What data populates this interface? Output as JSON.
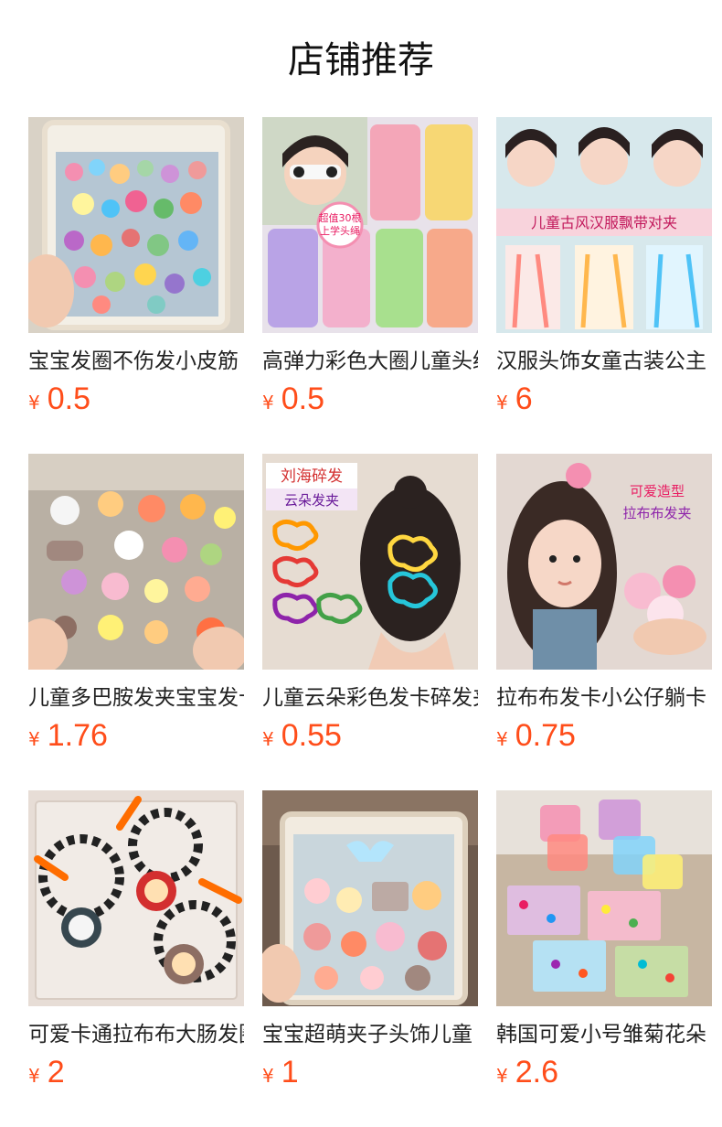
{
  "page": {
    "title": "店铺推荐"
  },
  "currency_symbol": "¥",
  "products": [
    {
      "name": "宝宝发圈不伤发小皮筋",
      "price": "0.5",
      "image_kind": "bag-of-hair-ties"
    },
    {
      "name": "高弹力彩色大圈儿童头绳",
      "price": "0.5",
      "image_kind": "girl-with-hair-ties",
      "image_overlay_text": [
        "超值30根",
        "上学头绳"
      ]
    },
    {
      "name": "汉服头饰女童古装公主",
      "price": "6",
      "image_kind": "hanfu-ribbon-clips",
      "image_overlay_text": [
        "儿童古风汉服飘带对夹"
      ]
    },
    {
      "name": "儿童多巴胺发夹宝宝发卡",
      "price": "1.76",
      "image_kind": "cartoon-clips-display"
    },
    {
      "name": "儿童云朵彩色发卡碎发夹",
      "price": "0.55",
      "image_kind": "cloud-clips",
      "image_overlay_text": [
        "刘海碎发",
        "云朵发夹"
      ]
    },
    {
      "name": "拉布布发卡小公仔躺卡",
      "price": "0.75",
      "image_kind": "doll-hair-clip",
      "image_overlay_text": [
        "可爱造型",
        "拉布布发夹"
      ]
    },
    {
      "name": "可爱卡通拉布布大肠发圈",
      "price": "2",
      "image_kind": "cartoon-hair-ring"
    },
    {
      "name": "宝宝超萌夹子头饰儿童",
      "price": "1",
      "image_kind": "bag-of-clips"
    },
    {
      "name": "韩国可爱小号雏菊花朵",
      "price": "2.6",
      "image_kind": "jars-of-mini-clips"
    }
  ]
}
